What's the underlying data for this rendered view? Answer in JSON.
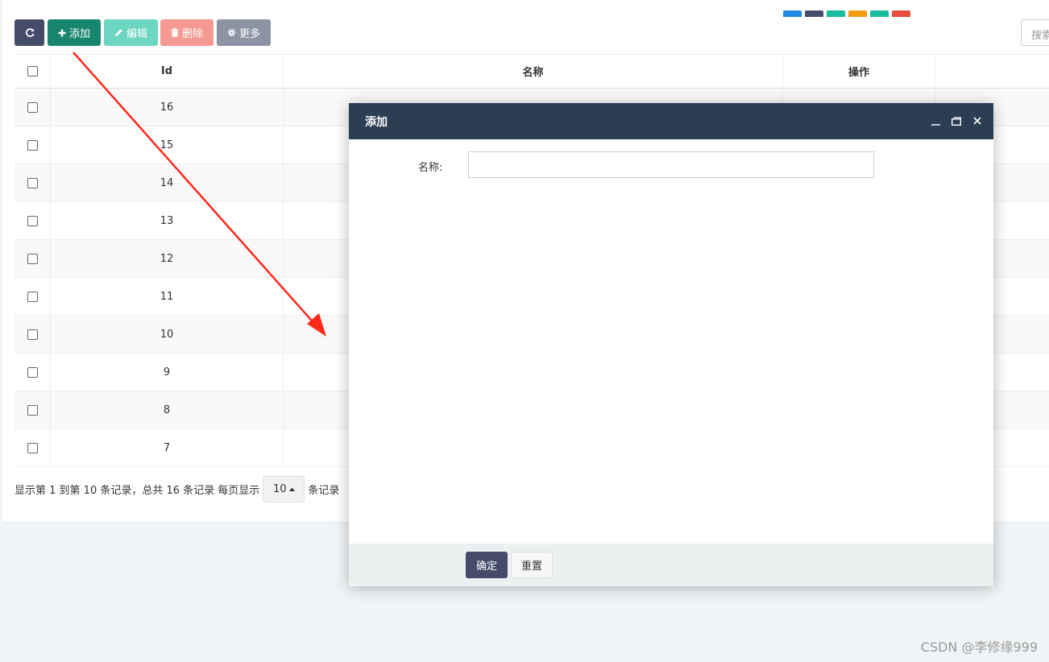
{
  "toolbar": {
    "refresh_icon": "refresh-icon",
    "add_label": "添加",
    "edit_label": "编辑",
    "delete_label": "删除",
    "more_label": "更多"
  },
  "search": {
    "placeholder": "搜索"
  },
  "table": {
    "headers": {
      "id": "Id",
      "name": "名称",
      "operate": "操作"
    },
    "rows": [
      {
        "id": "16"
      },
      {
        "id": "15"
      },
      {
        "id": "14"
      },
      {
        "id": "13"
      },
      {
        "id": "12"
      },
      {
        "id": "11"
      },
      {
        "id": "10"
      },
      {
        "id": "9"
      },
      {
        "id": "8"
      },
      {
        "id": "7"
      }
    ],
    "op_colors": [
      "#1e88e5",
      "#444c69",
      "#18bc9c",
      "#f39c12",
      "#18bc9c",
      "#e74c3c"
    ]
  },
  "pagination": {
    "summary": "显示第 1 到第 10 条记录，总共 16 条记录 每页显示",
    "page_size": "10",
    "suffix": "条记录"
  },
  "dialog": {
    "title": "添加",
    "name_label": "名称:",
    "name_value": "",
    "ok_label": "确定",
    "reset_label": "重置"
  },
  "watermark": "CSDN @李修缘999",
  "colors": {
    "primary": "#444c69",
    "success": "#18866f",
    "dialog_header": "#2c3e53",
    "arrow": "#ff2a1a"
  }
}
